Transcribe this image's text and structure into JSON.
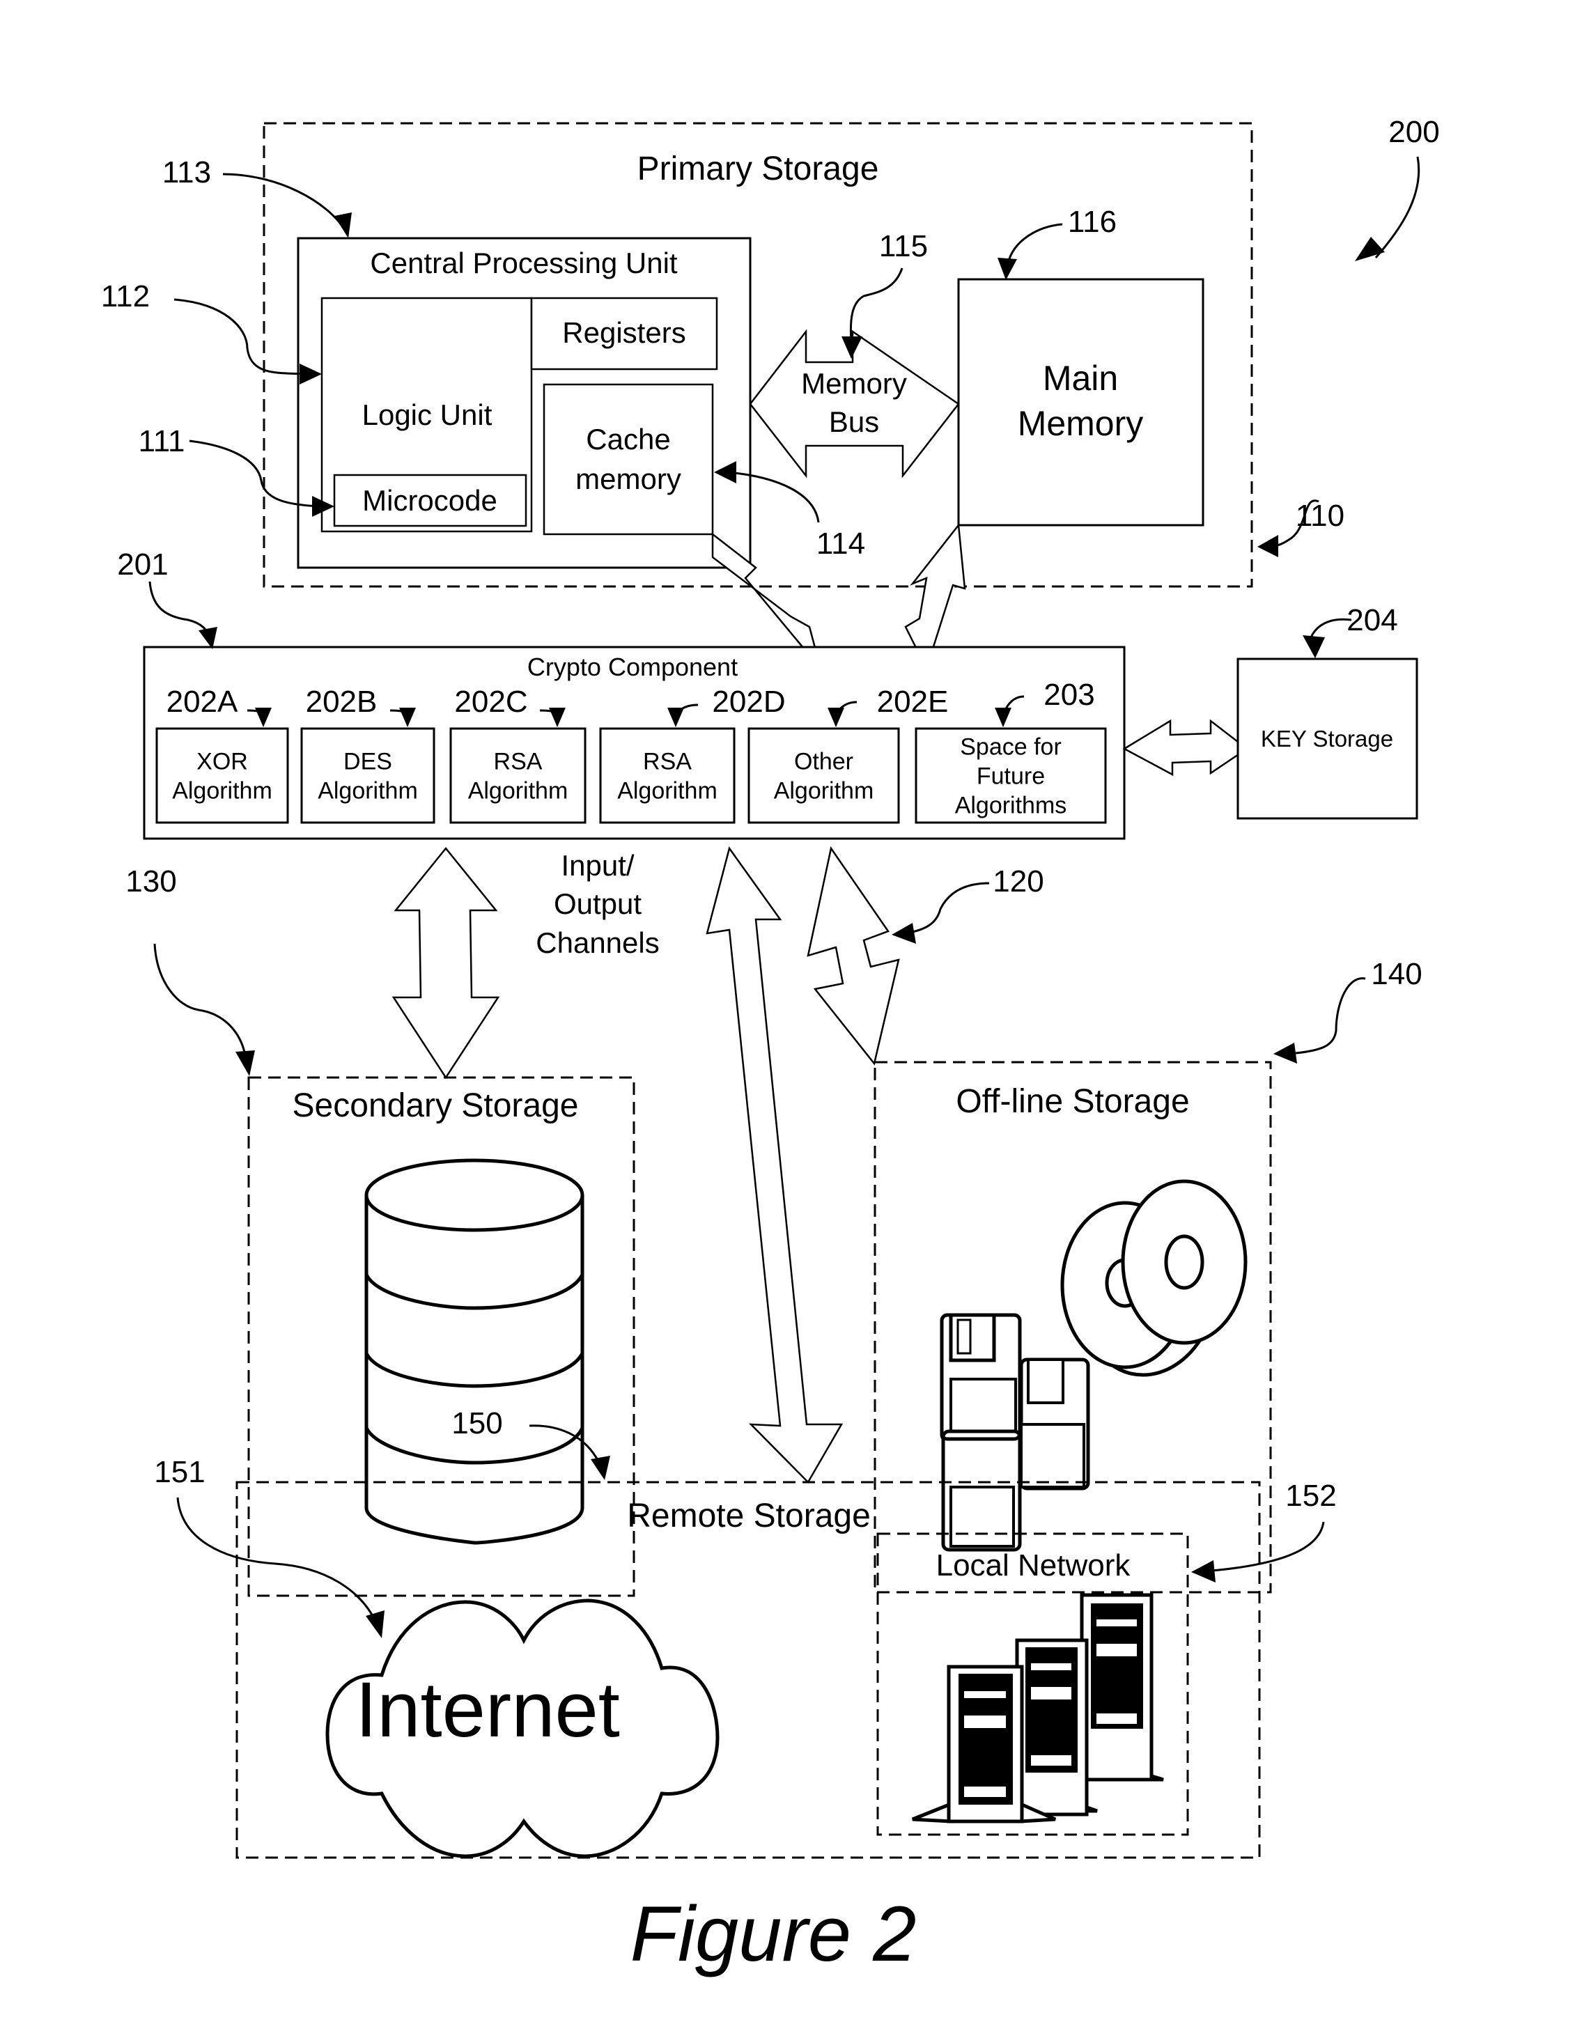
{
  "figure": {
    "caption": "Figure 2",
    "ref_overall": "200"
  },
  "primary_storage": {
    "title": "Primary Storage",
    "ref": "110",
    "cpu": {
      "title": "Central Processing Unit",
      "ref": "113",
      "logic_unit": {
        "label": "Logic Unit",
        "ref": "112"
      },
      "microcode": {
        "label": "Microcode",
        "ref": "111"
      },
      "registers": {
        "label": "Registers"
      },
      "cache": {
        "line1": "Cache",
        "line2": "memory",
        "ref": "114"
      }
    },
    "memory_bus": {
      "line1": "Memory",
      "line2": "Bus",
      "ref": "115"
    },
    "main_memory": {
      "line1": "Main",
      "line2": "Memory",
      "ref": "116"
    }
  },
  "crypto_component": {
    "title": "Crypto Component",
    "ref": "201",
    "algorithms": [
      {
        "ref": "202A",
        "line1": "XOR",
        "line2": "Algorithm",
        "line3": ""
      },
      {
        "ref": "202B",
        "line1": "DES",
        "line2": "Algorithm",
        "line3": ""
      },
      {
        "ref": "202C",
        "line1": "RSA",
        "line2": "Algorithm",
        "line3": ""
      },
      {
        "ref": "202D",
        "line1": "RSA",
        "line2": "Algorithm",
        "line3": ""
      },
      {
        "ref": "202E",
        "line1": "Other",
        "line2": "Algorithm",
        "line3": ""
      },
      {
        "ref": "203",
        "line1": "Space for",
        "line2": "Future",
        "line3": "Algorithms"
      }
    ]
  },
  "key_storage": {
    "label": "KEY Storage",
    "ref": "204"
  },
  "io_channels": {
    "line1": "Input/",
    "line2": "Output",
    "line3": "Channels",
    "ref": "120"
  },
  "secondary_storage": {
    "title": "Secondary Storage",
    "ref": "130",
    "icon": "database-icon"
  },
  "offline_storage": {
    "title": "Off-line Storage",
    "ref": "140",
    "icon": "disks-icon"
  },
  "remote_storage": {
    "title": "Remote Storage",
    "ref": "150",
    "internet": {
      "label": "Internet",
      "ref": "151",
      "icon": "cloud-icon"
    },
    "local_network": {
      "title": "Local Network",
      "ref": "152",
      "icon": "servers-icon"
    }
  }
}
